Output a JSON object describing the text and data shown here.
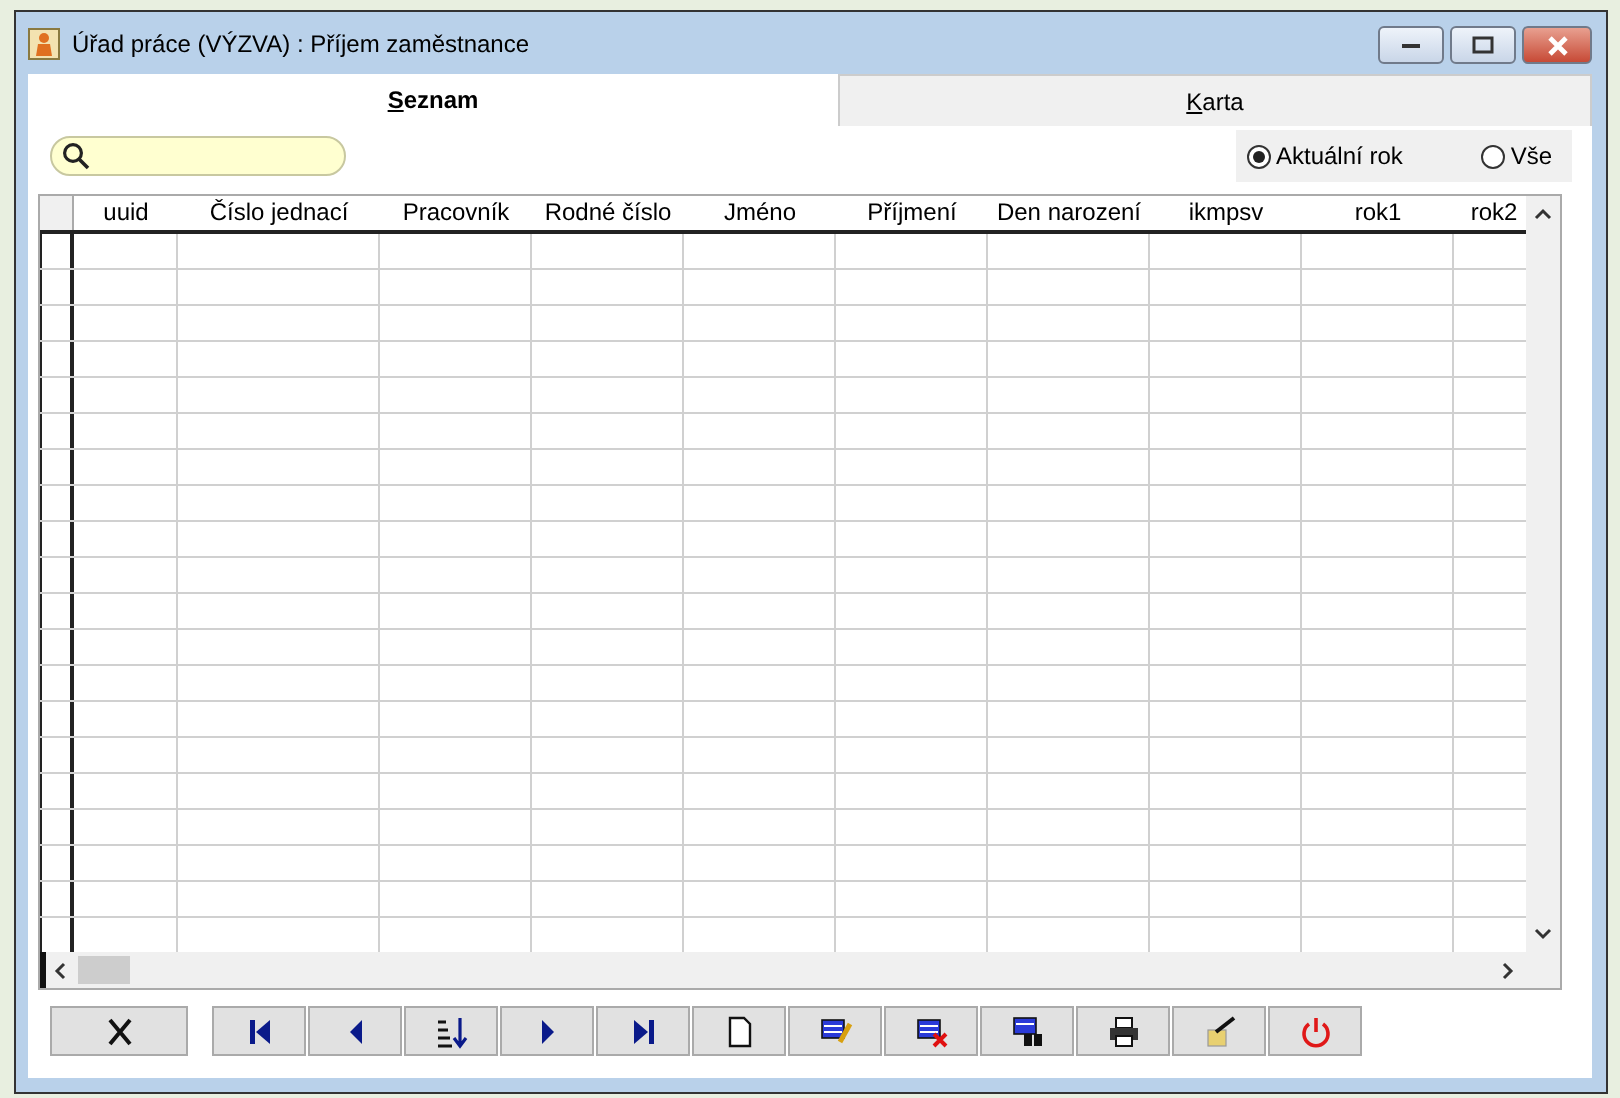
{
  "window": {
    "title": "Úřad práce (VÝZVA) : Příjem zaměstnance"
  },
  "tabs": [
    {
      "label": "Seznam",
      "selected": true
    },
    {
      "label": "Karta",
      "selected": false
    }
  ],
  "filter": [
    {
      "label": "Aktuální rok",
      "selected": true
    },
    {
      "label": "Vše",
      "selected": false
    }
  ],
  "table": {
    "columns": [
      "uuid",
      "Číslo jednací",
      "Pracovník",
      "Rodné číslo",
      "Jméno",
      "Příjmení",
      "Den narození",
      "ikmpsv",
      "rok1",
      "rok2"
    ]
  },
  "toolbar": [
    {
      "kind": "cancel"
    },
    {
      "kind": "first"
    },
    {
      "kind": "prev"
    },
    {
      "kind": "sort"
    },
    {
      "kind": "next"
    },
    {
      "kind": "last"
    },
    {
      "kind": "new"
    },
    {
      "kind": "edit"
    },
    {
      "kind": "delete"
    },
    {
      "kind": "find"
    },
    {
      "kind": "print"
    },
    {
      "kind": "wizard"
    },
    {
      "kind": "power"
    }
  ]
}
